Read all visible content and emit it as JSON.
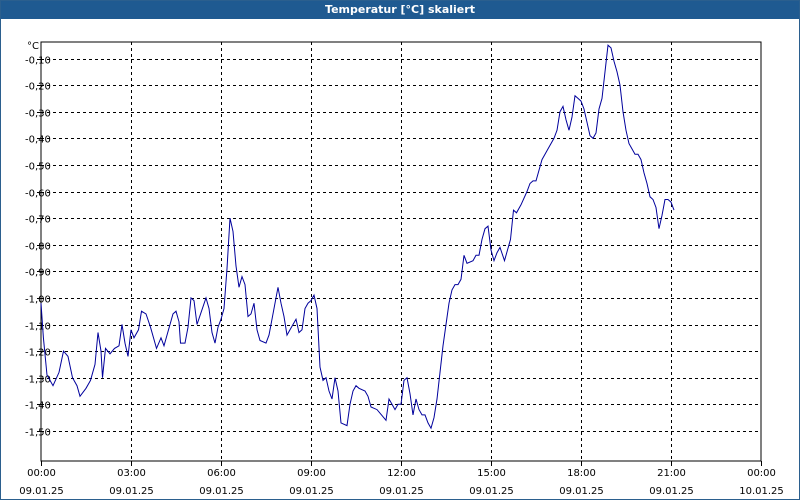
{
  "window": {
    "title": "Temperatur [°C] skaliert"
  },
  "colors": {
    "titlebar": "#1f5a91",
    "line": "#00009c",
    "grid": "#000000"
  },
  "chart_data": {
    "type": "line",
    "title": "Temperatur [°C] skaliert",
    "ylabel": "°C",
    "xlabel": "",
    "ylim": [
      -1.55,
      0
    ],
    "xlim": [
      0,
      24
    ],
    "y_ticks": [
      -0.1,
      -0.2,
      -0.3,
      -0.4,
      -0.5,
      -0.6,
      -0.7,
      -0.8,
      -0.9,
      -1.0,
      -1.1,
      -1.2,
      -1.3,
      -1.4,
      -1.5
    ],
    "y_tick_labels": [
      "-0,10",
      "-0,20",
      "-0,30",
      "-0,40",
      "-0,50",
      "-0,60",
      "-0,70",
      "-0,80",
      "-0,90",
      "-1,00",
      "-1,10",
      "-1,20",
      "-1,30",
      "-1,40",
      "-1,50"
    ],
    "x_ticks": [
      {
        "hours": 0,
        "time": "00:00",
        "date": "09.01.25"
      },
      {
        "hours": 3,
        "time": "03:00",
        "date": "09.01.25"
      },
      {
        "hours": 6,
        "time": "06:00",
        "date": "09.01.25"
      },
      {
        "hours": 9,
        "time": "09:00",
        "date": "09.01.25"
      },
      {
        "hours": 12,
        "time": "12:00",
        "date": "09.01.25"
      },
      {
        "hours": 15,
        "time": "15:00",
        "date": "09.01.25"
      },
      {
        "hours": 18,
        "time": "18:00",
        "date": "09.01.25"
      },
      {
        "hours": 21,
        "time": "21:00",
        "date": "09.01.25"
      },
      {
        "hours": 24,
        "time": "00:00",
        "date": "10.01.25"
      }
    ],
    "grid": true,
    "series": [
      {
        "points": [
          [
            0.0,
            -1.02
          ],
          [
            0.08,
            -1.15
          ],
          [
            0.2,
            -1.29
          ],
          [
            0.4,
            -1.33
          ],
          [
            0.6,
            -1.28
          ],
          [
            0.75,
            -1.2
          ],
          [
            0.9,
            -1.22
          ],
          [
            1.05,
            -1.3
          ],
          [
            1.2,
            -1.33
          ],
          [
            1.3,
            -1.37
          ],
          [
            1.5,
            -1.34
          ],
          [
            1.65,
            -1.31
          ],
          [
            1.8,
            -1.25
          ],
          [
            1.9,
            -1.13
          ],
          [
            2.0,
            -1.2
          ],
          [
            2.05,
            -1.3
          ],
          [
            2.15,
            -1.19
          ],
          [
            2.3,
            -1.21
          ],
          [
            2.45,
            -1.19
          ],
          [
            2.6,
            -1.18
          ],
          [
            2.7,
            -1.1
          ],
          [
            2.8,
            -1.17
          ],
          [
            2.9,
            -1.22
          ],
          [
            3.0,
            -1.12
          ],
          [
            3.1,
            -1.15
          ],
          [
            3.25,
            -1.12
          ],
          [
            3.35,
            -1.05
          ],
          [
            3.5,
            -1.06
          ],
          [
            3.65,
            -1.11
          ],
          [
            3.75,
            -1.15
          ],
          [
            3.85,
            -1.19
          ],
          [
            4.0,
            -1.15
          ],
          [
            4.1,
            -1.18
          ],
          [
            4.3,
            -1.1
          ],
          [
            4.4,
            -1.06
          ],
          [
            4.5,
            -1.05
          ],
          [
            4.6,
            -1.09
          ],
          [
            4.65,
            -1.17
          ],
          [
            4.8,
            -1.17
          ],
          [
            4.9,
            -1.11
          ],
          [
            5.0,
            -1.0
          ],
          [
            5.1,
            -1.01
          ],
          [
            5.2,
            -1.1
          ],
          [
            5.35,
            -1.05
          ],
          [
            5.5,
            -1.0
          ],
          [
            5.6,
            -1.04
          ],
          [
            5.7,
            -1.13
          ],
          [
            5.8,
            -1.17
          ],
          [
            5.9,
            -1.11
          ],
          [
            6.0,
            -1.08
          ],
          [
            6.1,
            -1.04
          ],
          [
            6.2,
            -0.89
          ],
          [
            6.3,
            -0.7
          ],
          [
            6.4,
            -0.75
          ],
          [
            6.5,
            -0.88
          ],
          [
            6.6,
            -0.96
          ],
          [
            6.7,
            -0.92
          ],
          [
            6.8,
            -0.95
          ],
          [
            6.9,
            -1.07
          ],
          [
            7.0,
            -1.06
          ],
          [
            7.1,
            -1.02
          ],
          [
            7.2,
            -1.12
          ],
          [
            7.3,
            -1.16
          ],
          [
            7.5,
            -1.17
          ],
          [
            7.6,
            -1.14
          ],
          [
            7.7,
            -1.08
          ],
          [
            7.8,
            -1.02
          ],
          [
            7.9,
            -0.96
          ],
          [
            8.0,
            -1.02
          ],
          [
            8.1,
            -1.07
          ],
          [
            8.2,
            -1.14
          ],
          [
            8.3,
            -1.12
          ],
          [
            8.5,
            -1.08
          ],
          [
            8.6,
            -1.13
          ],
          [
            8.7,
            -1.12
          ],
          [
            8.8,
            -1.04
          ],
          [
            8.9,
            -1.02
          ],
          [
            9.0,
            -1.01
          ],
          [
            9.1,
            -0.99
          ],
          [
            9.2,
            -1.04
          ],
          [
            9.3,
            -1.26
          ],
          [
            9.4,
            -1.31
          ],
          [
            9.5,
            -1.3
          ],
          [
            9.6,
            -1.35
          ],
          [
            9.7,
            -1.38
          ],
          [
            9.8,
            -1.3
          ],
          [
            9.9,
            -1.35
          ],
          [
            10.0,
            -1.47
          ],
          [
            10.2,
            -1.48
          ],
          [
            10.3,
            -1.4
          ],
          [
            10.4,
            -1.35
          ],
          [
            10.5,
            -1.33
          ],
          [
            10.6,
            -1.34
          ],
          [
            10.8,
            -1.35
          ],
          [
            10.9,
            -1.37
          ],
          [
            11.0,
            -1.41
          ],
          [
            11.2,
            -1.42
          ],
          [
            11.35,
            -1.44
          ],
          [
            11.5,
            -1.46
          ],
          [
            11.6,
            -1.38
          ],
          [
            11.7,
            -1.4
          ],
          [
            11.8,
            -1.42
          ],
          [
            11.9,
            -1.4
          ],
          [
            12.0,
            -1.4
          ],
          [
            12.1,
            -1.31
          ],
          [
            12.2,
            -1.3
          ],
          [
            12.3,
            -1.36
          ],
          [
            12.4,
            -1.44
          ],
          [
            12.5,
            -1.38
          ],
          [
            12.6,
            -1.42
          ],
          [
            12.7,
            -1.44
          ],
          [
            12.8,
            -1.44
          ],
          [
            12.9,
            -1.47
          ],
          [
            13.0,
            -1.49
          ],
          [
            13.1,
            -1.45
          ],
          [
            13.2,
            -1.38
          ],
          [
            13.3,
            -1.28
          ],
          [
            13.4,
            -1.18
          ],
          [
            13.5,
            -1.1
          ],
          [
            13.6,
            -1.02
          ],
          [
            13.7,
            -0.97
          ],
          [
            13.8,
            -0.95
          ],
          [
            13.9,
            -0.95
          ],
          [
            14.0,
            -0.93
          ],
          [
            14.1,
            -0.84
          ],
          [
            14.2,
            -0.87
          ],
          [
            14.4,
            -0.86
          ],
          [
            14.5,
            -0.84
          ],
          [
            14.6,
            -0.84
          ],
          [
            14.7,
            -0.78
          ],
          [
            14.8,
            -0.74
          ],
          [
            14.9,
            -0.73
          ],
          [
            15.0,
            -0.82
          ],
          [
            15.1,
            -0.86
          ],
          [
            15.2,
            -0.83
          ],
          [
            15.3,
            -0.81
          ],
          [
            15.45,
            -0.86
          ],
          [
            15.55,
            -0.82
          ],
          [
            15.65,
            -0.78
          ],
          [
            15.75,
            -0.67
          ],
          [
            15.85,
            -0.68
          ],
          [
            16.0,
            -0.65
          ],
          [
            16.2,
            -0.6
          ],
          [
            16.3,
            -0.57
          ],
          [
            16.4,
            -0.56
          ],
          [
            16.5,
            -0.56
          ],
          [
            16.6,
            -0.52
          ],
          [
            16.7,
            -0.48
          ],
          [
            16.8,
            -0.46
          ],
          [
            16.9,
            -0.44
          ],
          [
            17.1,
            -0.4
          ],
          [
            17.2,
            -0.37
          ],
          [
            17.3,
            -0.3
          ],
          [
            17.4,
            -0.28
          ],
          [
            17.5,
            -0.33
          ],
          [
            17.6,
            -0.37
          ],
          [
            17.7,
            -0.32
          ],
          [
            17.8,
            -0.24
          ],
          [
            17.9,
            -0.25
          ],
          [
            18.0,
            -0.26
          ],
          [
            18.1,
            -0.29
          ],
          [
            18.2,
            -0.34
          ],
          [
            18.3,
            -0.39
          ],
          [
            18.4,
            -0.4
          ],
          [
            18.5,
            -0.38
          ],
          [
            18.6,
            -0.29
          ],
          [
            18.7,
            -0.25
          ],
          [
            18.8,
            -0.15
          ],
          [
            18.9,
            -0.05
          ],
          [
            19.0,
            -0.06
          ],
          [
            19.1,
            -0.11
          ],
          [
            19.2,
            -0.15
          ],
          [
            19.3,
            -0.2
          ],
          [
            19.4,
            -0.3
          ],
          [
            19.5,
            -0.37
          ],
          [
            19.6,
            -0.42
          ],
          [
            19.7,
            -0.44
          ],
          [
            19.8,
            -0.46
          ],
          [
            19.9,
            -0.46
          ],
          [
            20.0,
            -0.48
          ],
          [
            20.1,
            -0.53
          ],
          [
            20.2,
            -0.57
          ],
          [
            20.3,
            -0.62
          ],
          [
            20.4,
            -0.63
          ],
          [
            20.5,
            -0.66
          ],
          [
            20.6,
            -0.74
          ],
          [
            20.7,
            -0.69
          ],
          [
            20.8,
            -0.63
          ],
          [
            20.9,
            -0.63
          ],
          [
            21.0,
            -0.64
          ],
          [
            21.1,
            -0.67
          ]
        ]
      }
    ]
  }
}
